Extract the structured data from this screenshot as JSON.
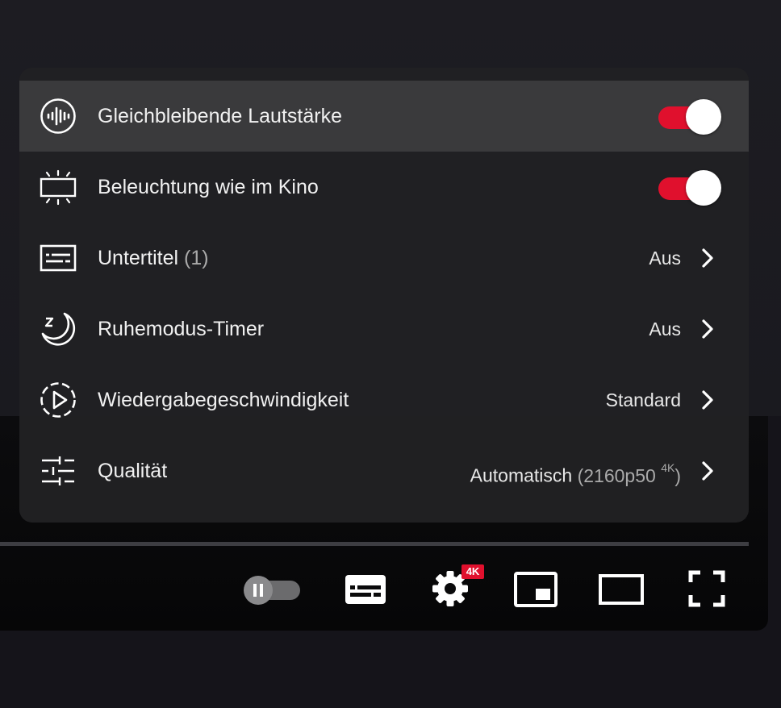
{
  "settings_menu": {
    "items": [
      {
        "label": "Gleichbleibende Lautstärke",
        "type": "toggle",
        "on": true,
        "icon": "stable-volume-icon"
      },
      {
        "label": "Beleuchtung wie im Kino",
        "type": "toggle",
        "on": true,
        "icon": "ambient-mode-icon"
      },
      {
        "label": "Untertitel",
        "label_suffix": "(1)",
        "type": "submenu",
        "value": "Aus",
        "icon": "subtitles-icon"
      },
      {
        "label": "Ruhemodus-Timer",
        "type": "submenu",
        "value": "Aus",
        "icon": "sleep-timer-icon"
      },
      {
        "label": "Wiedergabegeschwindigkeit",
        "type": "submenu",
        "value": "Standard",
        "icon": "playback-speed-icon"
      },
      {
        "label": "Qualität",
        "type": "submenu",
        "value": "Automatisch",
        "value_detail": "(2160p50",
        "value_sup": "4K",
        "value_close": ")",
        "icon": "quality-sliders-icon"
      }
    ]
  },
  "controls": {
    "autoplay": {
      "state": "paused"
    },
    "settings_badge": "4K"
  },
  "colors": {
    "accent": "#e0102d",
    "panel_bg": "#212123",
    "highlight": "#3a3a3c"
  }
}
